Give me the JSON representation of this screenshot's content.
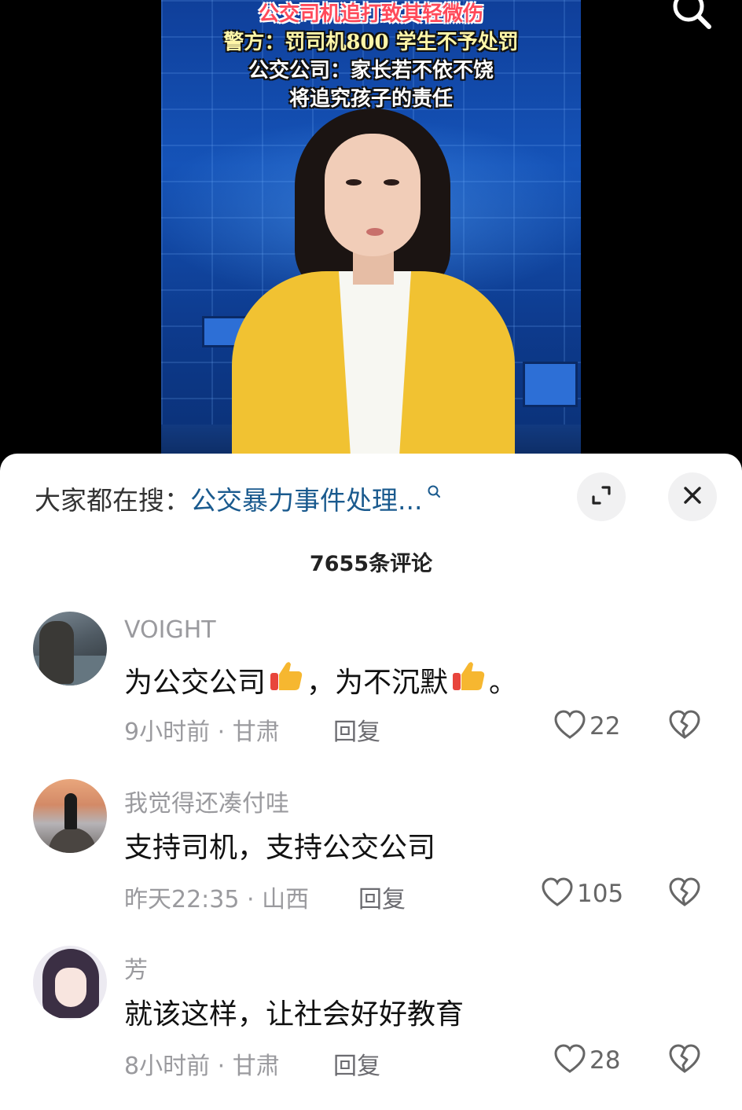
{
  "video": {
    "headline_lines": [
      "公交司机追打致其轻微伤",
      "警方：罚司机800  学生不予处罚",
      "公交公司：家长若不依不饶",
      "将追究孩子的责任"
    ]
  },
  "panel": {
    "search_prefix": "大家都在搜：",
    "search_term": "公交暴力事件处理...",
    "comment_count": "7655条评论"
  },
  "comments": [
    {
      "username": "VOIGHT",
      "text_parts": [
        "为公交公司",
        "，为不沉默",
        "。"
      ],
      "emoji": "thumbs-up",
      "time": "9小时前",
      "location": "甘肃",
      "reply_label": "回复",
      "likes": "22"
    },
    {
      "username": "我觉得还凑付哇",
      "text": "支持司机，支持公交公司",
      "time": "昨天22:35",
      "location": "山西",
      "reply_label": "回复",
      "likes": "105"
    },
    {
      "username": "芳",
      "text": "就该这样，让社会好好教育",
      "time": "8小时前",
      "location": "甘肃",
      "reply_label": "回复",
      "likes": "28"
    }
  ],
  "meta_separator": " · ",
  "icons": {
    "top_search": "search-icon",
    "expand": "expand-icon",
    "close": "close-icon",
    "like": "heart-icon",
    "dislike": "broken-heart-icon"
  },
  "colors": {
    "search_term": "#1a5a8e",
    "muted_text": "#9a9a9e",
    "panel_bg": "#ffffff"
  }
}
